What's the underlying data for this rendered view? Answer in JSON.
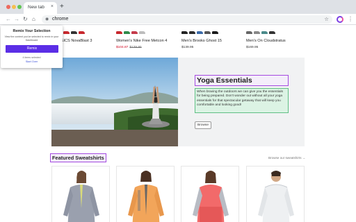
{
  "browser": {
    "tab_title": "New tab",
    "tab_close": "×",
    "new_tab": "+",
    "address": "chrome",
    "icons": [
      "back-arrow-icon",
      "forward-arrow-icon",
      "reload-icon",
      "home-icon",
      "site-info-icon",
      "bookmark-star-icon",
      "extension-icon",
      "menu-icon"
    ]
  },
  "products_top": [
    {
      "name": "ASICS NovaBlast 3",
      "price": "",
      "sale_price": "",
      "original_price": ""
    },
    {
      "name": "Women's Nike Free Metcon 4",
      "price": "",
      "sale_price": "$104.87",
      "original_price": "$139.95"
    },
    {
      "name": "Men's Brooks Ghost 15",
      "price": "$139.95",
      "sale_price": "",
      "original_price": ""
    },
    {
      "name": "Men's On Cloudstratus",
      "price": "$169.95",
      "sale_price": "",
      "original_price": ""
    }
  ],
  "banner": {
    "title": "Yoga Essentials",
    "description": "When braving the outdoors we can give you the essentials for being prepared. Don't wonder out without all your yoga essentials for that spectacular getaway that will keep you comfortable and looking good!",
    "button_label": "Browse"
  },
  "featured": {
    "title": "Featured Sweatshirts",
    "link": "Browse our sweatshirts →"
  },
  "popup": {
    "title": "Remix Your Selection",
    "description": "View the content you've selected to remix in your Dashboard",
    "button_label": "Remix",
    "selected_text": "4 items selected",
    "start_over": "Start Over"
  },
  "colors": {
    "accent_purple": "#5b2ee6",
    "highlight_purple": "#a44ae0",
    "highlight_green": "#5fbf83",
    "sale_red": "#d0021b"
  }
}
